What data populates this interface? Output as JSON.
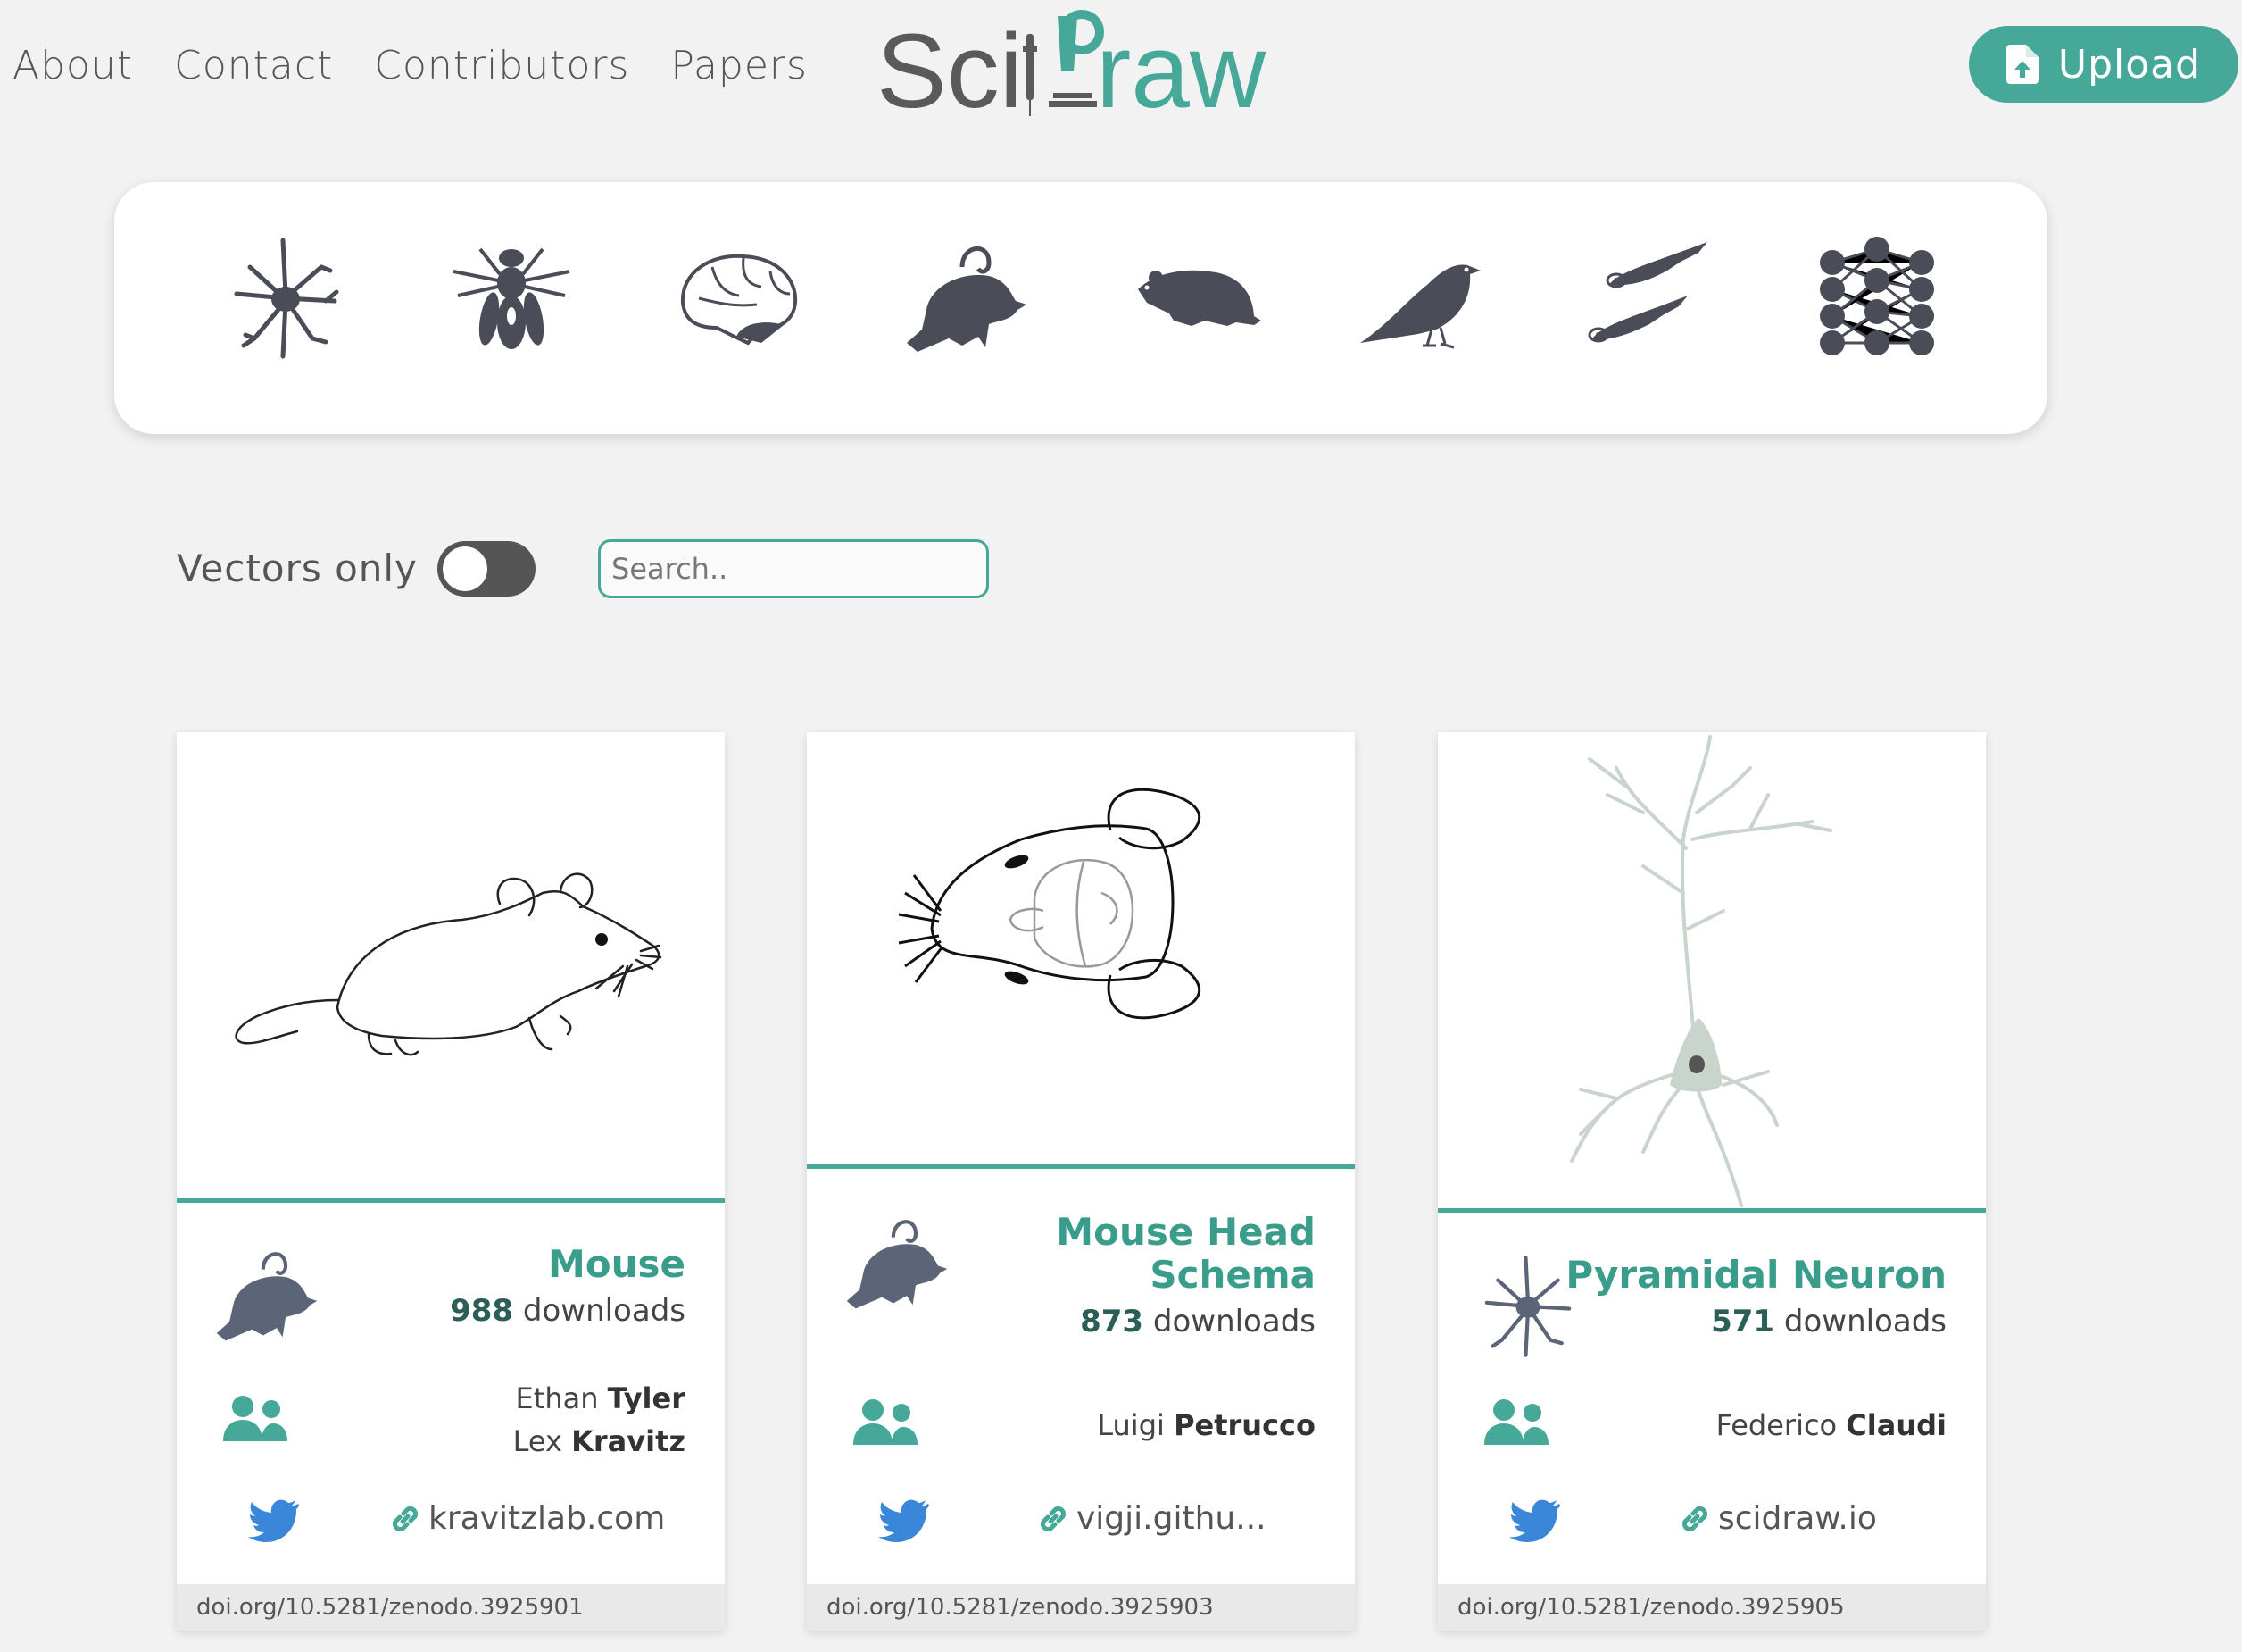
{
  "nav": {
    "items": [
      "About",
      "Contact",
      "Contributors",
      "Papers"
    ]
  },
  "logo": {
    "text_sci": "Sci",
    "text_draw": "raw"
  },
  "upload": {
    "label": "Upload"
  },
  "categories": {
    "icons": [
      "neuron-icon",
      "fly-icon",
      "brain-icon",
      "mouse-icon",
      "rat-icon",
      "bird-icon",
      "zebrafish-icon",
      "neural-network-icon"
    ]
  },
  "filters": {
    "vectors_only_label": "Vectors only",
    "vectors_only": false,
    "search_placeholder": "Search.."
  },
  "colors": {
    "accent": "#45a898",
    "dark_icon": "#4a4d57",
    "card_icon": "#5b6577"
  },
  "cards": [
    {
      "title": "Mouse",
      "downloads_count": "988",
      "downloads_label": "downloads",
      "authors": [
        {
          "first": "Ethan",
          "last": "Tyler"
        },
        {
          "first": "Lex",
          "last": "Kravitz"
        }
      ],
      "link": "kravitzlab.com",
      "doi": "doi.org/10.5281/zenodo.3925901",
      "species_icon": "mouse-icon"
    },
    {
      "title_line1": "Mouse Head",
      "title_line2": "Schema",
      "downloads_count": "873",
      "downloads_label": "downloads",
      "authors": [
        {
          "first": "Luigi",
          "last": "Petrucco"
        }
      ],
      "link": "vigji.githu...",
      "doi": "doi.org/10.5281/zenodo.3925903",
      "species_icon": "mouse-icon"
    },
    {
      "title": "Pyramidal Neuron",
      "downloads_count": "571",
      "downloads_label": "downloads",
      "authors": [
        {
          "first": "Federico",
          "last": "Claudi"
        }
      ],
      "link": "scidraw.io",
      "doi": "doi.org/10.5281/zenodo.3925905",
      "species_icon": "neuron-icon"
    }
  ]
}
